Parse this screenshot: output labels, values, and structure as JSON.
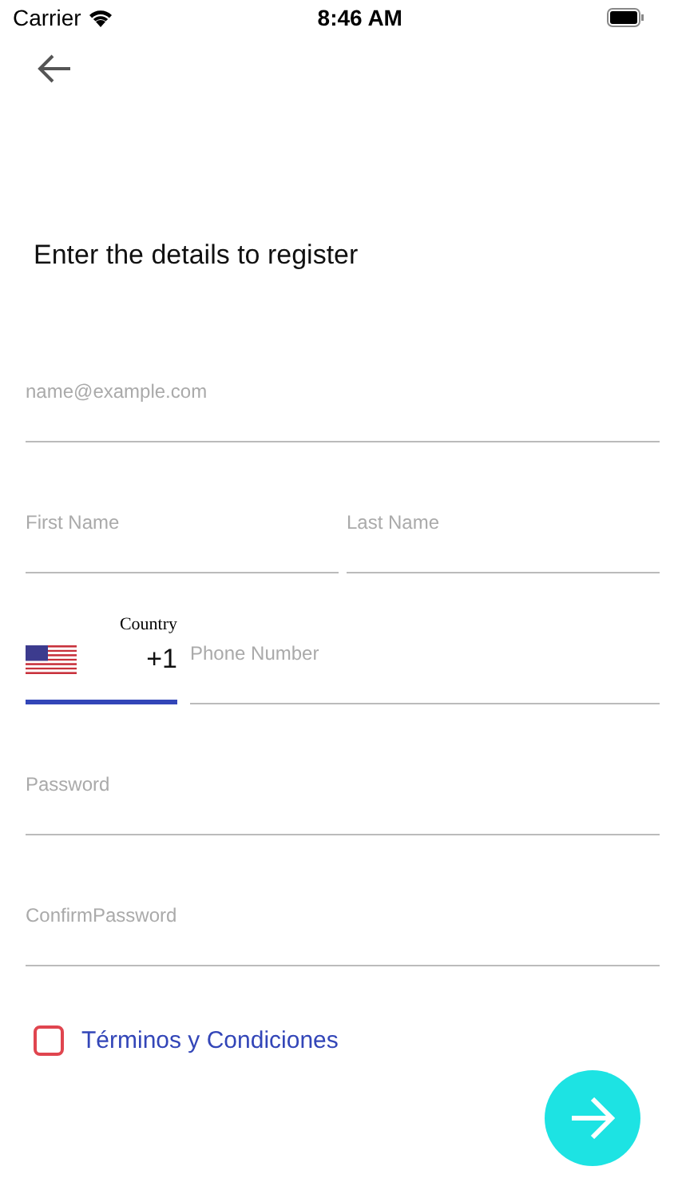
{
  "status_bar": {
    "carrier": "Carrier",
    "time": "8:46 AM"
  },
  "title": "Enter the details to register",
  "email": {
    "placeholder": "name@example.com"
  },
  "first_name": {
    "placeholder": "First Name"
  },
  "last_name": {
    "placeholder": "Last Name"
  },
  "country": {
    "label": "Country",
    "code": "+1",
    "focused": true
  },
  "phone": {
    "placeholder": "Phone Number"
  },
  "password": {
    "placeholder": "Password"
  },
  "confirm_password": {
    "placeholder": "ConfirmPassword"
  },
  "terms": {
    "label": "Términos y Condiciones",
    "checked": false
  }
}
